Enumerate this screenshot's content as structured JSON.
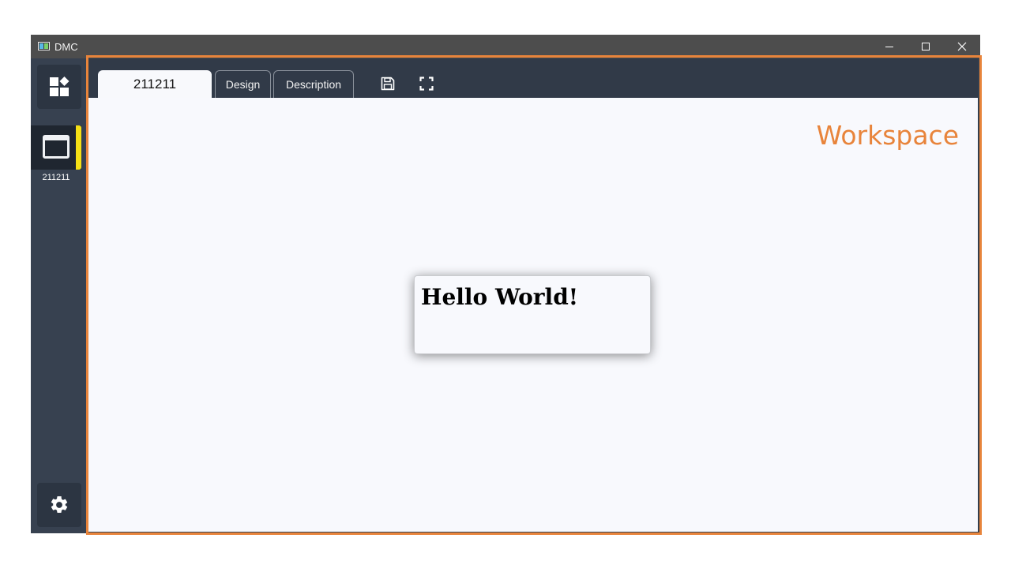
{
  "window": {
    "title": "DMC"
  },
  "sidebar": {
    "open_item": {
      "label": "211211"
    }
  },
  "tabs": [
    {
      "label": "211211",
      "active": true
    },
    {
      "label": "Design",
      "active": false
    },
    {
      "label": "Description",
      "active": false
    }
  ],
  "toolbar": {
    "icons": [
      "save-icon",
      "fullscreen-icon"
    ]
  },
  "workspace": {
    "label": "Workspace",
    "card_text": "Hello World!"
  },
  "colors": {
    "accent": "#e8843b",
    "active_marker": "#f5e015",
    "sidebar_bg": "#374150",
    "canvas_bg": "#f8f9fd"
  }
}
